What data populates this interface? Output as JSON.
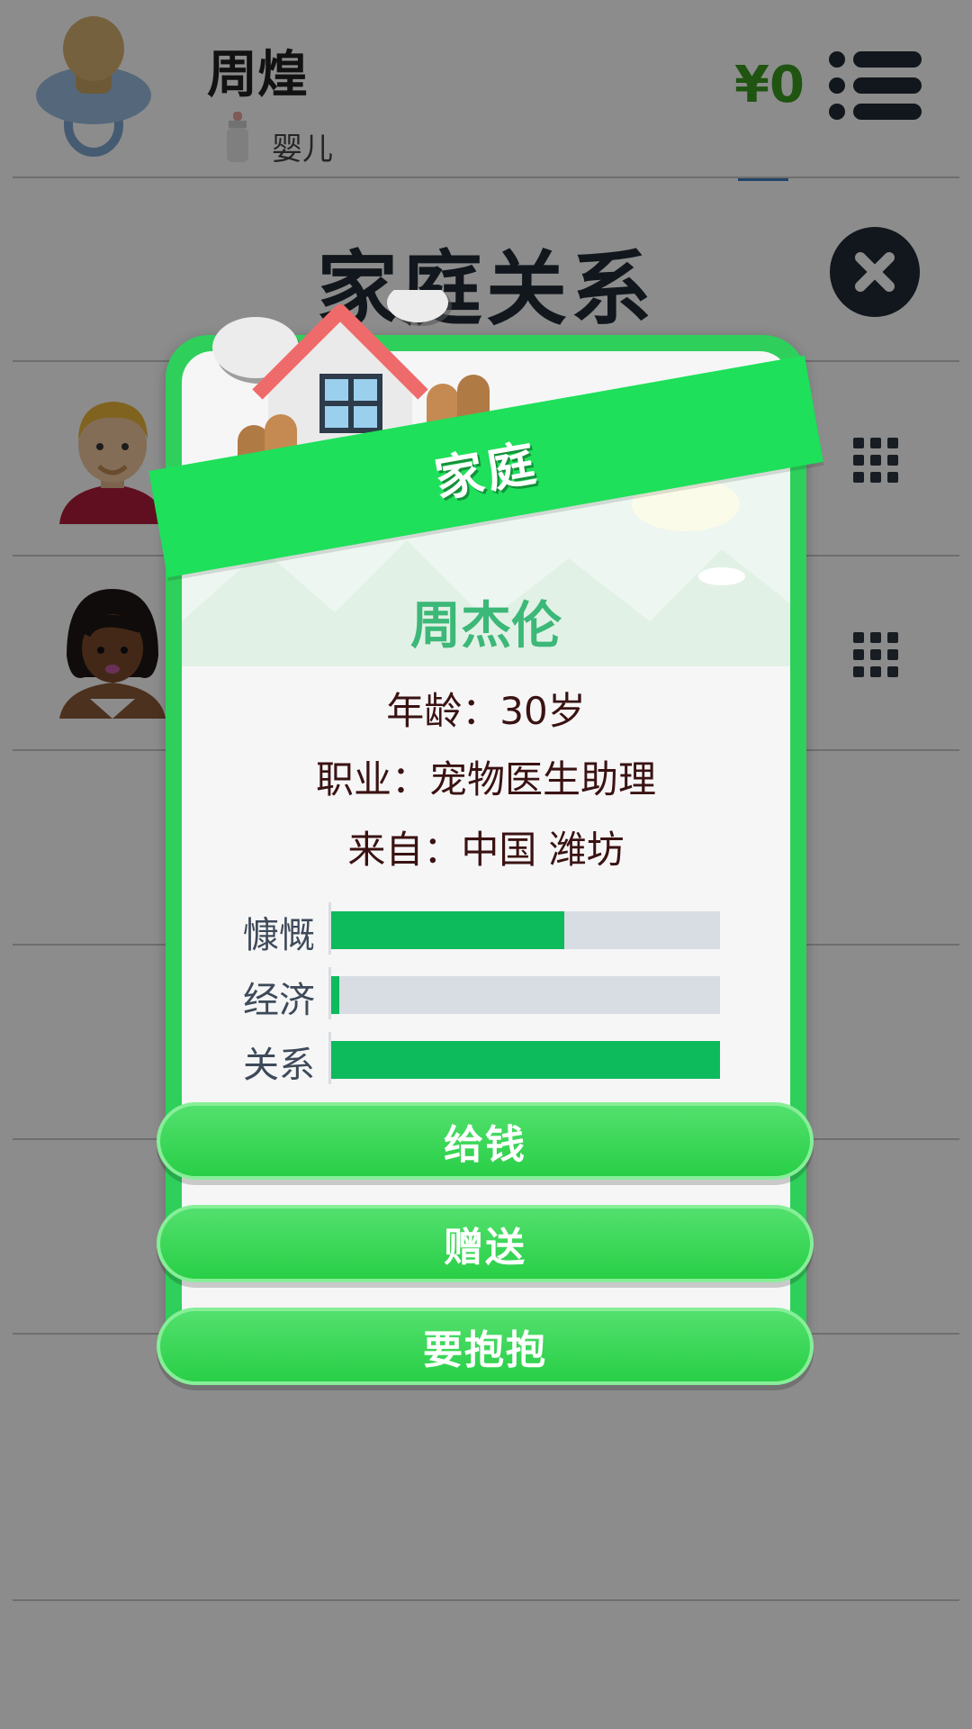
{
  "header": {
    "player_name": "周煌",
    "life_stage": "婴儿",
    "money": "¥0"
  },
  "page": {
    "title": "家庭关系"
  },
  "modal": {
    "banner_label": "家庭",
    "person_name": "周杰伦",
    "age_line": "年龄：30岁",
    "job_line": "职业：宠物医生助理",
    "from_line": "来自：中国 潍坊",
    "stats": [
      {
        "label": "慷慨",
        "level": 0.6
      },
      {
        "label": "经济",
        "level": 0.02
      },
      {
        "label": "关系",
        "level": 1.0
      }
    ],
    "buttons": [
      {
        "label": "给钱"
      },
      {
        "label": "赠送"
      },
      {
        "label": "要抱抱"
      }
    ]
  },
  "colors": {
    "accent_green": "#2fcf5c",
    "stat_fill": "#0dba5c",
    "money_green": "#3a9a20"
  }
}
